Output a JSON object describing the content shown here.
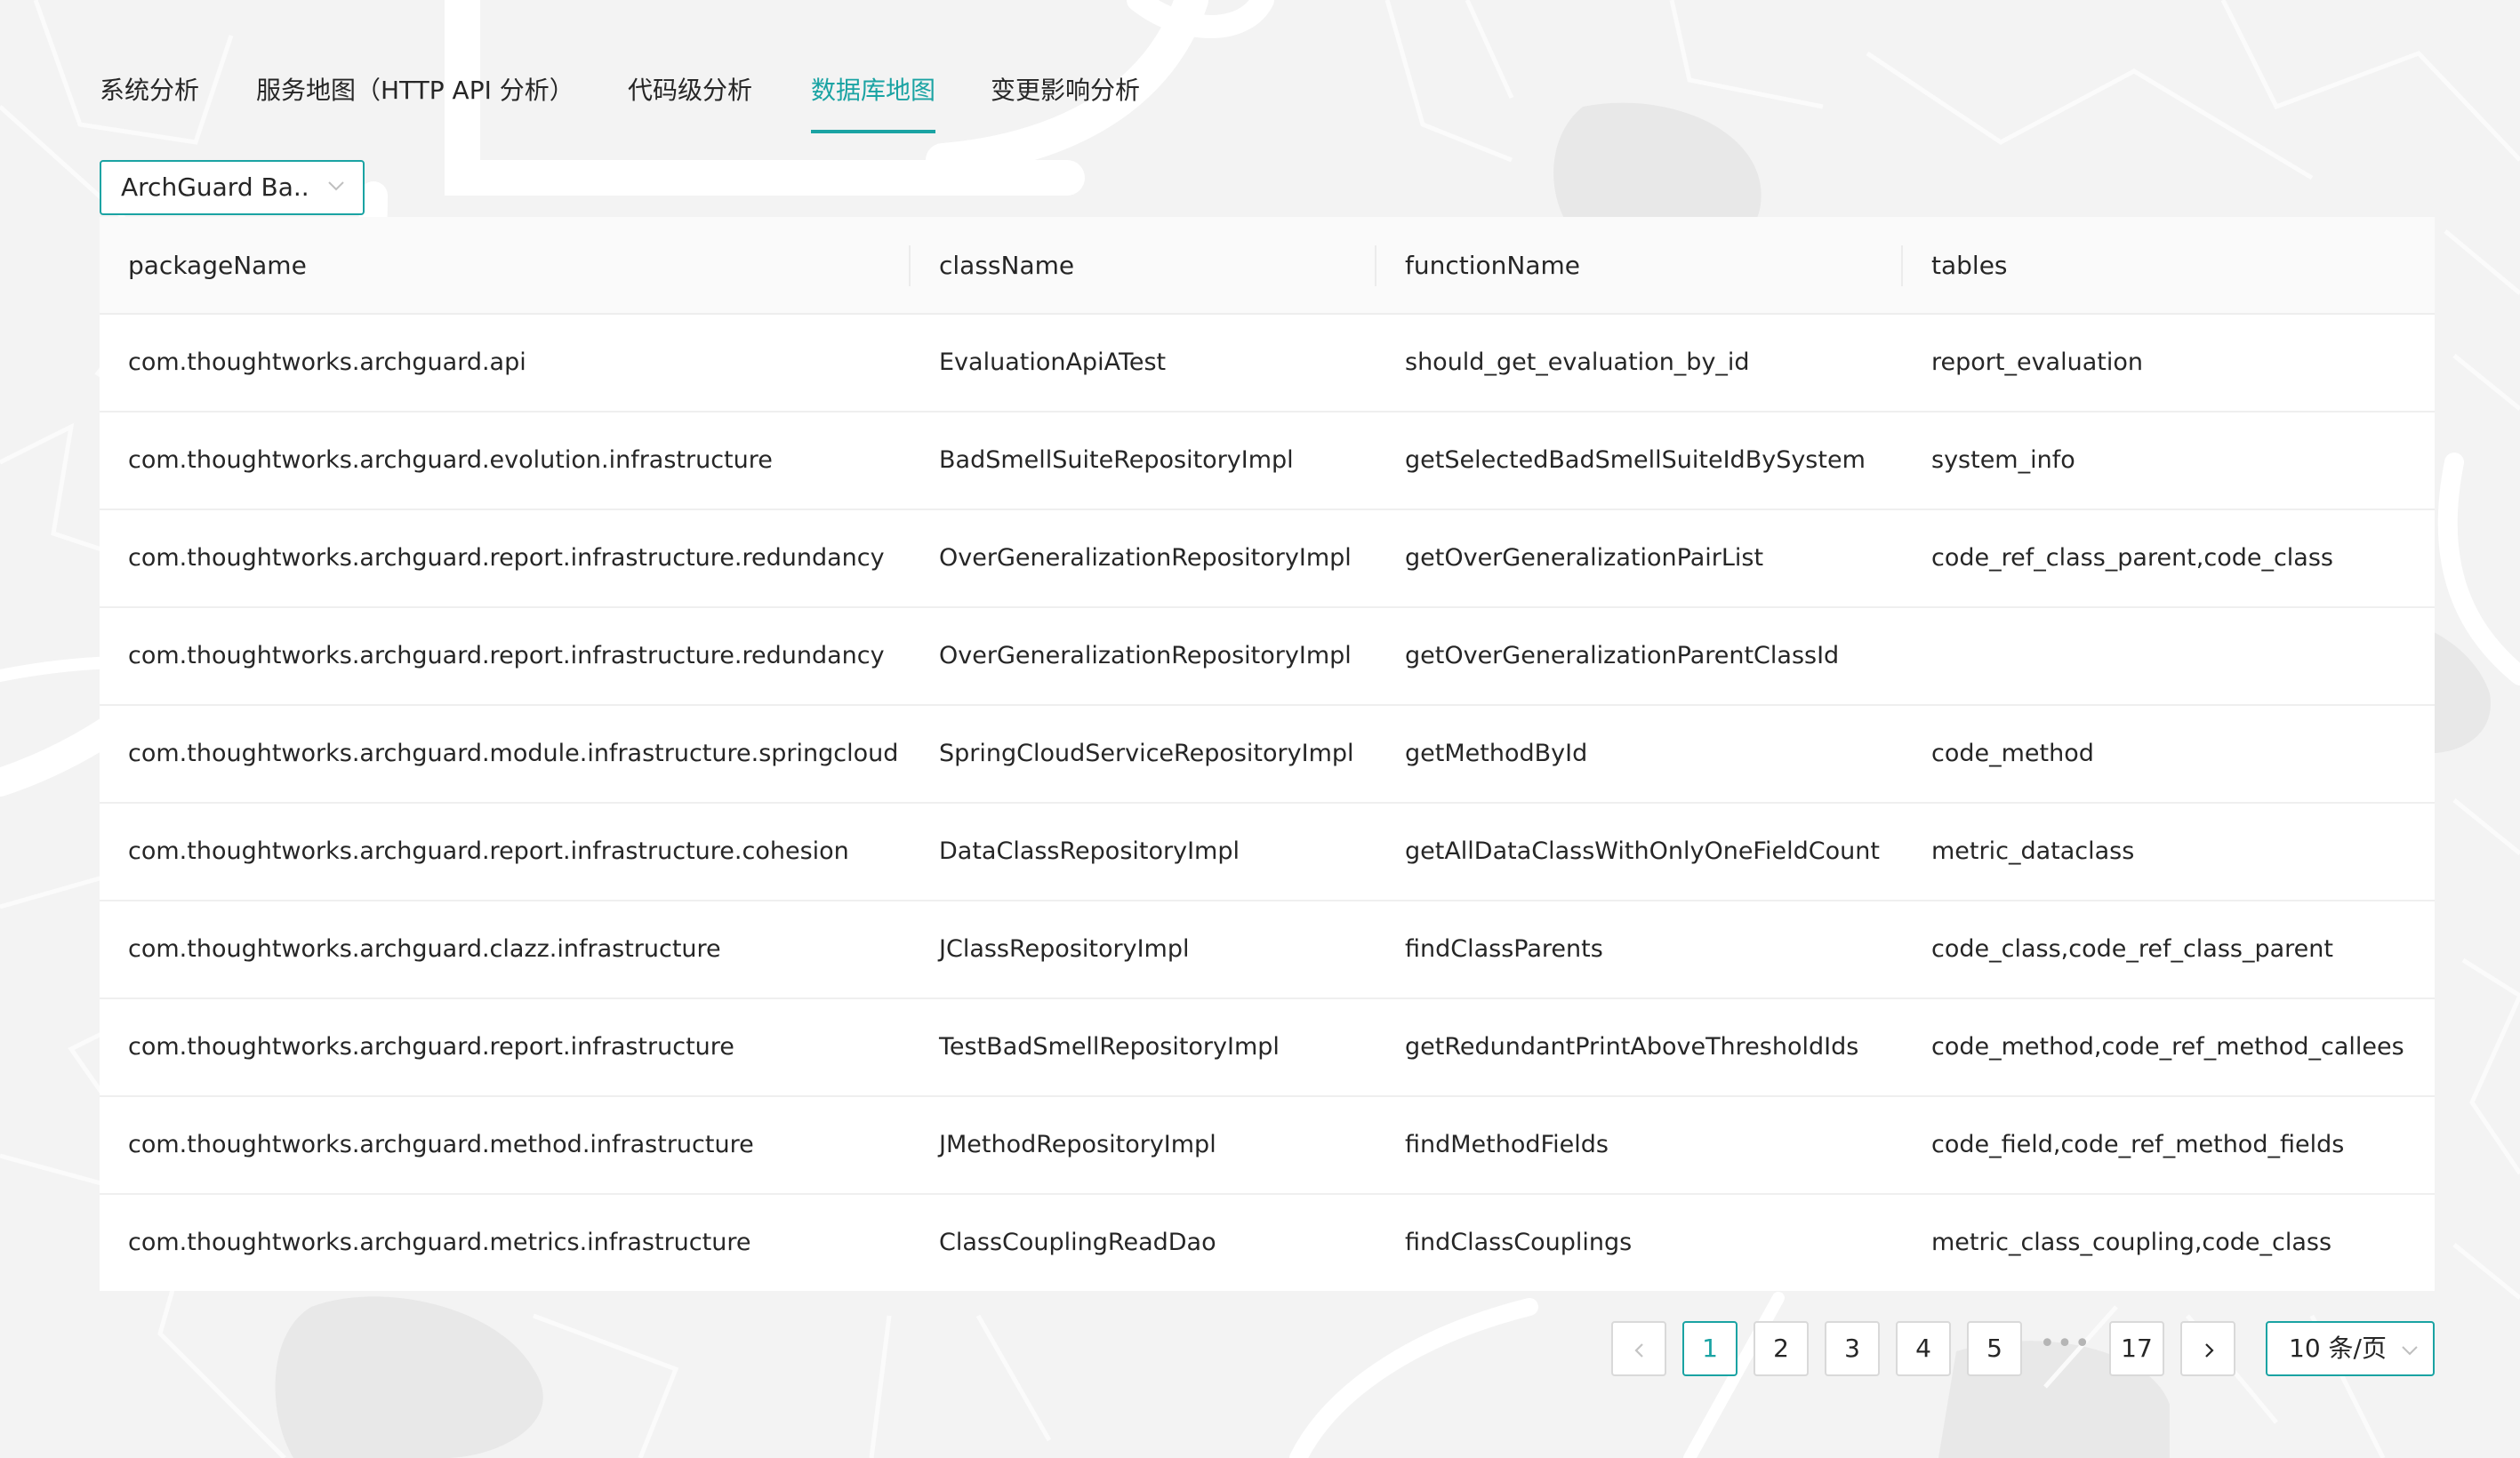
{
  "tabs": [
    {
      "label": "系统分析",
      "active": false
    },
    {
      "label": "服务地图（HTTP API 分析）",
      "active": false
    },
    {
      "label": "代码级分析",
      "active": false
    },
    {
      "label": "数据库地图",
      "active": true
    },
    {
      "label": "变更影响分析",
      "active": false
    }
  ],
  "system_select": {
    "value": "ArchGuard Ba...",
    "icon": "chevron-down-icon"
  },
  "table": {
    "columns": [
      "packageName",
      "className",
      "functionName",
      "tables"
    ],
    "rows": [
      [
        "com.thoughtworks.archguard.api",
        "EvaluationApiATest",
        "should_get_evaluation_by_id",
        "report_evaluation"
      ],
      [
        "com.thoughtworks.archguard.evolution.infrastructure",
        "BadSmellSuiteRepositoryImpl",
        "getSelectedBadSmellSuiteIdBySystem",
        "system_info"
      ],
      [
        "com.thoughtworks.archguard.report.infrastructure.redundancy",
        "OverGeneralizationRepositoryImpl",
        "getOverGeneralizationPairList",
        "code_ref_class_parent,code_class"
      ],
      [
        "com.thoughtworks.archguard.report.infrastructure.redundancy",
        "OverGeneralizationRepositoryImpl",
        "getOverGeneralizationParentClassId",
        ""
      ],
      [
        "com.thoughtworks.archguard.module.infrastructure.springcloud",
        "SpringCloudServiceRepositoryImpl",
        "getMethodById",
        "code_method"
      ],
      [
        "com.thoughtworks.archguard.report.infrastructure.cohesion",
        "DataClassRepositoryImpl",
        "getAllDataClassWithOnlyOneFieldCount",
        "metric_dataclass"
      ],
      [
        "com.thoughtworks.archguard.clazz.infrastructure",
        "JClassRepositoryImpl",
        "findClassParents",
        "code_class,code_ref_class_parent"
      ],
      [
        "com.thoughtworks.archguard.report.infrastructure",
        "TestBadSmellRepositoryImpl",
        "getRedundantPrintAboveThresholdIds",
        "code_method,code_ref_method_callees"
      ],
      [
        "com.thoughtworks.archguard.method.infrastructure",
        "JMethodRepositoryImpl",
        "findMethodFields",
        "code_field,code_ref_method_fields"
      ],
      [
        "com.thoughtworks.archguard.metrics.infrastructure",
        "ClassCouplingReadDao",
        "findClassCouplings",
        "metric_class_coupling,code_class"
      ]
    ]
  },
  "pagination": {
    "prev_icon": "chevron-left-icon",
    "next_icon": "chevron-right-icon",
    "pages": [
      "1",
      "2",
      "3",
      "4",
      "5"
    ],
    "current_page": "1",
    "ellipsis": "•••",
    "last_page": "17",
    "page_size": "10 条/页",
    "page_size_icon": "chevron-down-icon"
  },
  "colors": {
    "accent": "#1aa3a3",
    "text": "#262626",
    "border": "#d9d9d9",
    "background": "#f3f3f3"
  }
}
